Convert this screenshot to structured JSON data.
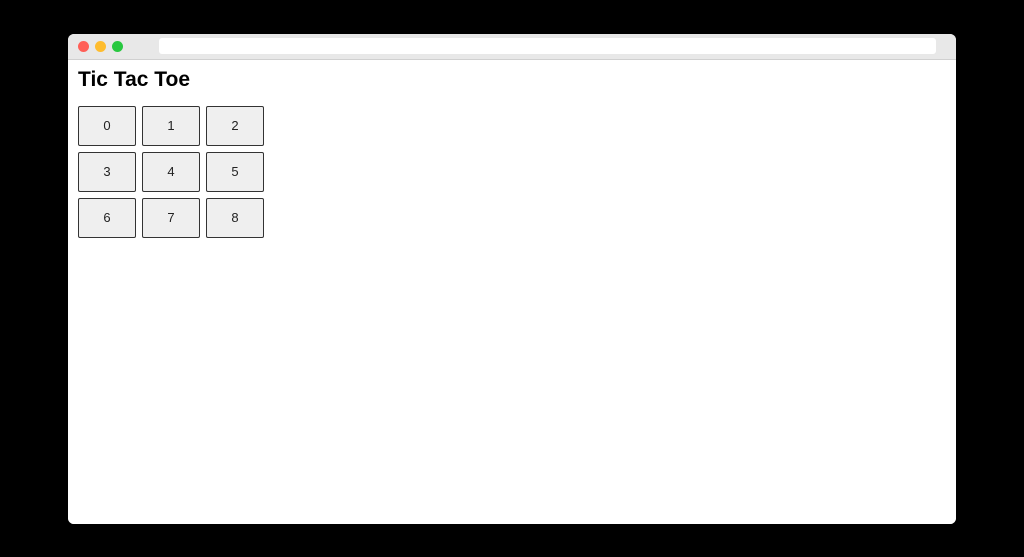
{
  "header": {
    "title": "Tic Tac Toe"
  },
  "board": {
    "cells": [
      "0",
      "1",
      "2",
      "3",
      "4",
      "5",
      "6",
      "7",
      "8"
    ]
  }
}
